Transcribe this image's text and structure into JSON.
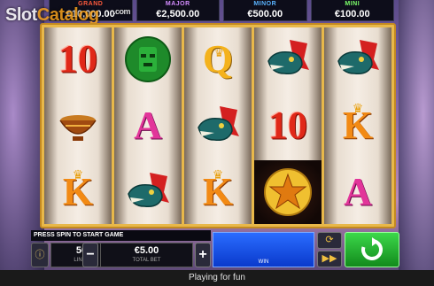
{
  "watermark": {
    "slot": "Slot",
    "catalog": "Catalog",
    "dotcom": ".com"
  },
  "jackpots": [
    {
      "name": "GRAND",
      "value": "€10,000.00"
    },
    {
      "name": "MAJOR",
      "value": "€2,500.00"
    },
    {
      "name": "MINOR",
      "value": "€500.00"
    },
    {
      "name": "MINI",
      "value": "€100.00"
    }
  ],
  "reels": [
    [
      "10",
      "bowl",
      "K"
    ],
    [
      "mask",
      "A",
      "serpent"
    ],
    [
      "Q",
      "serpent",
      "K"
    ],
    [
      "serpent",
      "10",
      "star"
    ],
    [
      "serpent",
      "K",
      "A"
    ]
  ],
  "controls": {
    "message": "PRESS SPIN TO START GAME",
    "lines_value": "50",
    "lines_label": "LINES",
    "bet_value": "€5.00",
    "bet_label": "TOTAL BET",
    "win_label": "WIN",
    "info_icon": "info-icon",
    "minus": "−",
    "plus": "+"
  },
  "footer": {
    "text": "Playing for fun"
  },
  "colors": {
    "spin": "#1fae2a",
    "win": "#1a54e8",
    "frame": "#e8b84a"
  }
}
